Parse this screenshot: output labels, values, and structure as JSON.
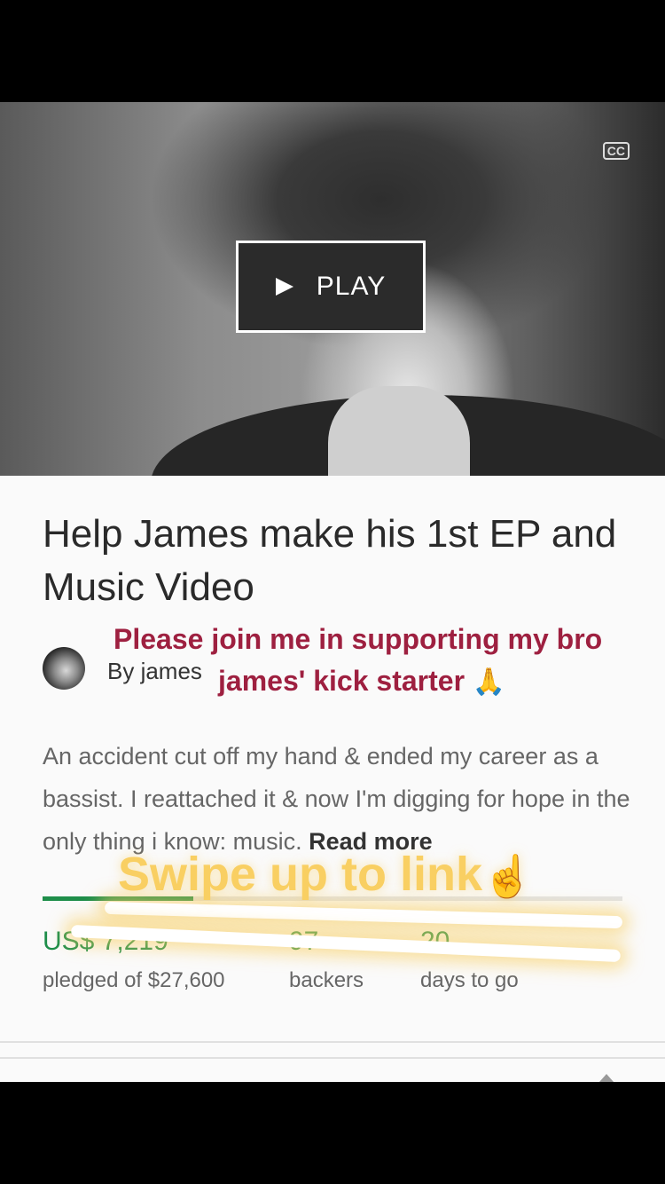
{
  "video": {
    "cc_label": "CC",
    "play_label": "PLAY"
  },
  "project": {
    "title": "Help James make his 1st EP and Music Video",
    "byline": "By james",
    "description": "An accident cut off my hand & ended my career as a bassist. I reattached it & now I'm digging for hope in the only thing i know: music.",
    "read_more": "Read more"
  },
  "overlay": {
    "line1": "Please join me in supporting my bro",
    "line2": "james' kick starter",
    "pray_emoji": "🙏",
    "swipe_text": "Swipe up to link",
    "finger_emoji": "☝",
    "text_color": "#9e2040",
    "swipe_color": "#f9cf62"
  },
  "stats": {
    "pledged_value": "US$ 7,219",
    "pledged_label": "pledged of $27,600",
    "backers_value": "97",
    "backers_label": "backers",
    "days_value": "20",
    "days_label": "days to go",
    "progress_fraction": 0.26,
    "accent_color": "#1e8e4a"
  }
}
